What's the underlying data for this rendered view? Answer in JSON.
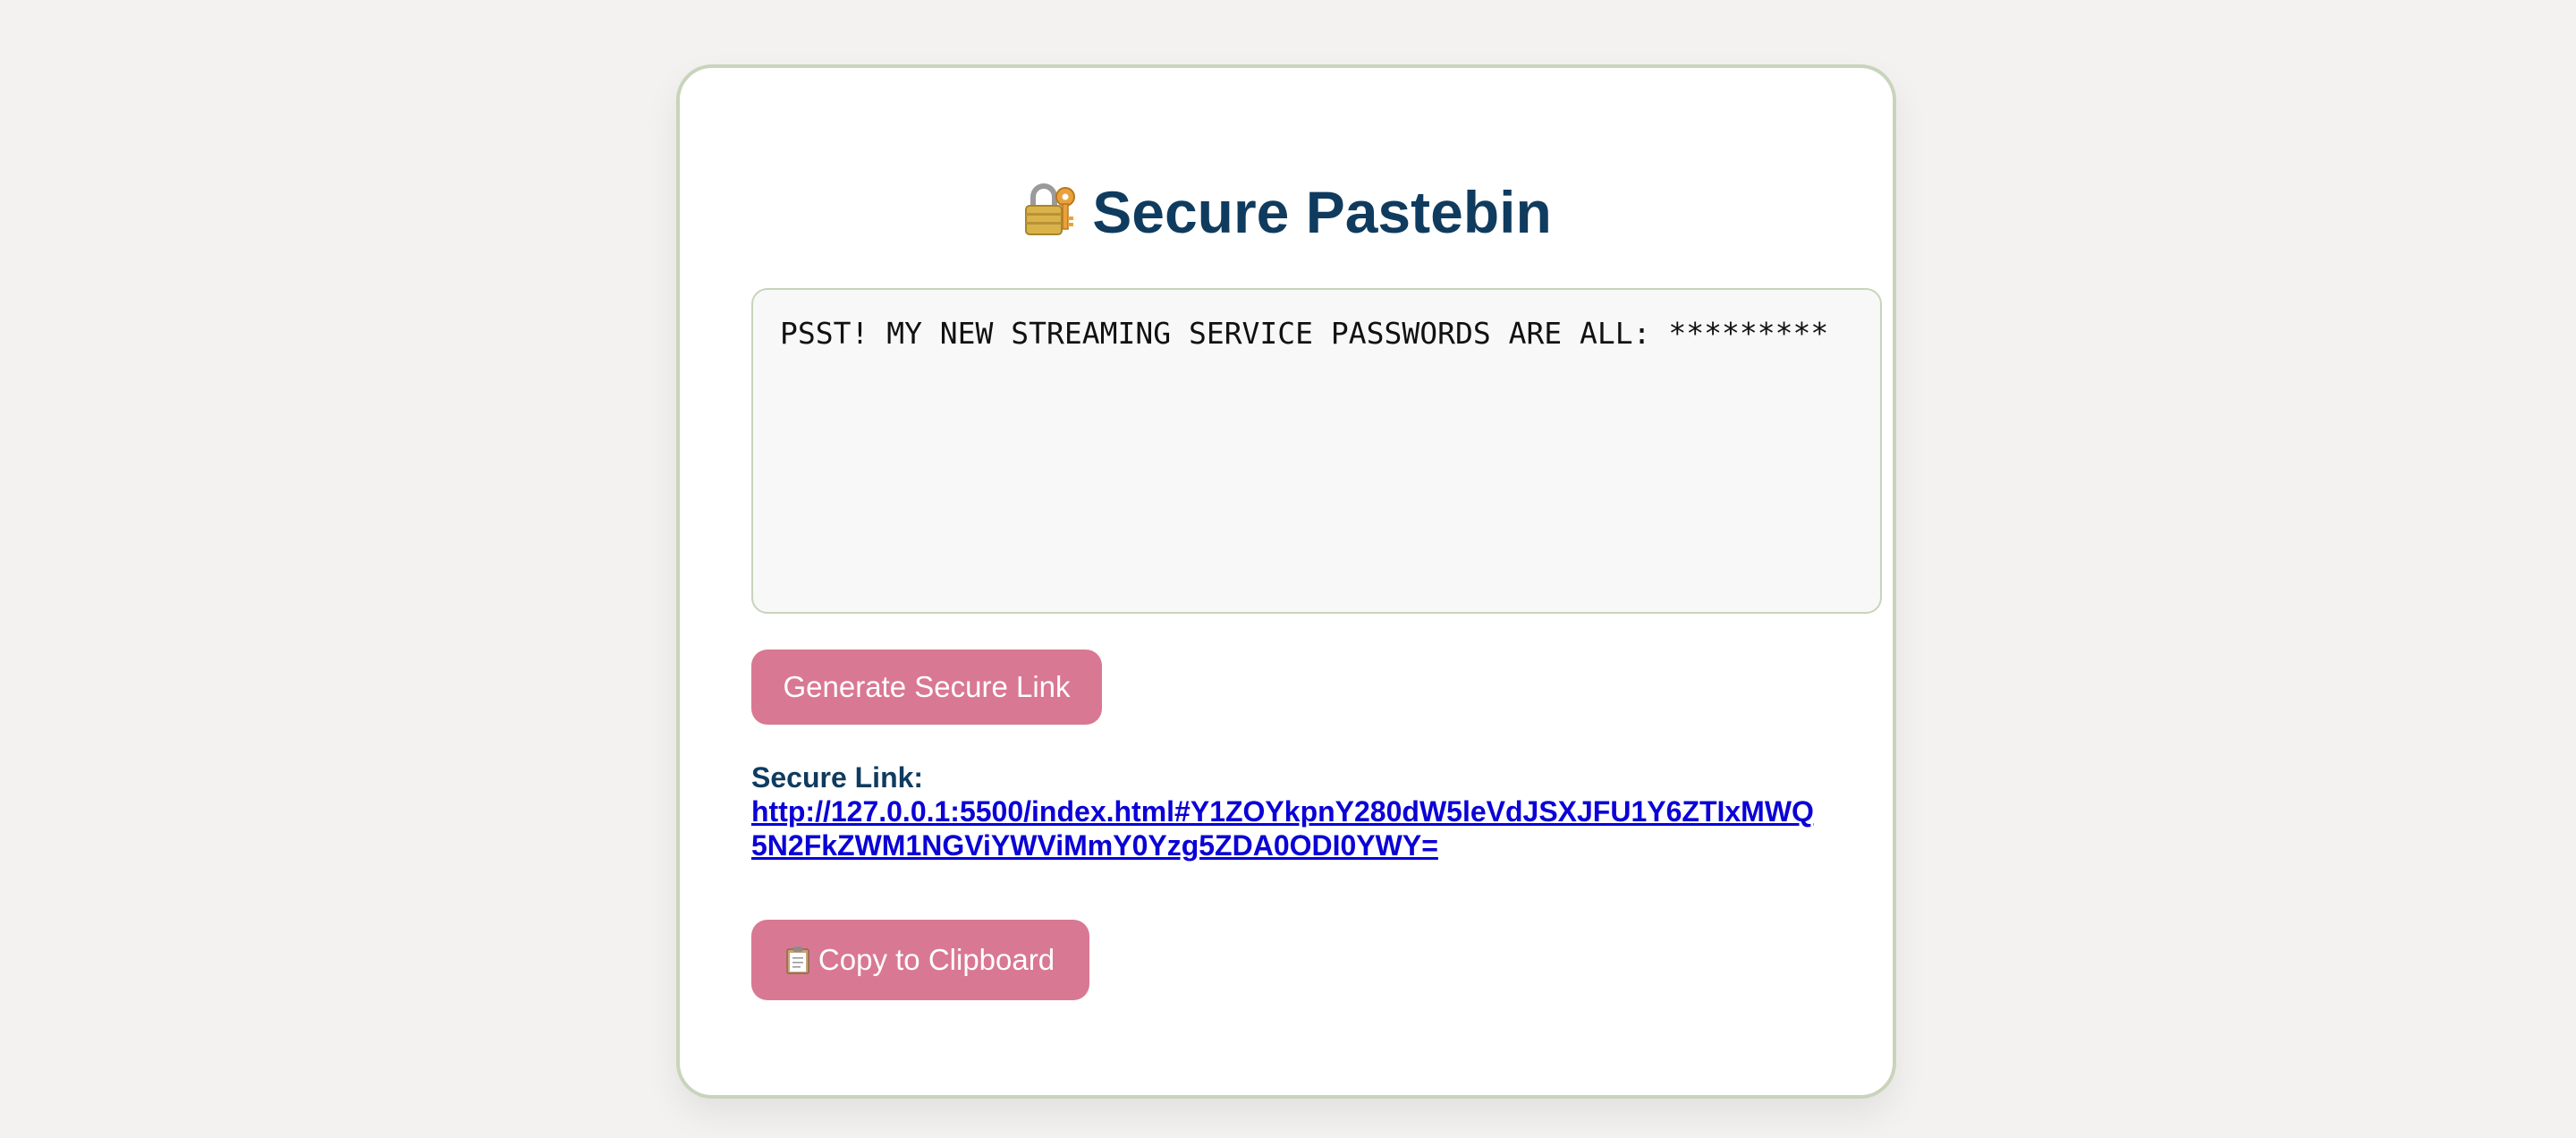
{
  "app": {
    "title": "Secure Pastebin",
    "title_icon": "lock-with-key-icon"
  },
  "paste": {
    "content": "PSST! MY NEW STREAMING SERVICE PASSWORDS ARE ALL: *********"
  },
  "actions": {
    "generate_label": "Generate Secure Link",
    "copy_label": "Copy to Clipboard",
    "copy_icon": "clipboard-icon"
  },
  "result": {
    "label": "Secure Link:",
    "url": "http://127.0.0.1:5500/index.html#Y1ZOYkpnY280dW5leVdJSXJFU1Y6ZTIxMWQ5N2FkZWM1NGViYWViMmY0Yzg5ZDA0ODI0YWY="
  },
  "colors": {
    "background": "#f3f2f0",
    "card_border": "#c8d4bb",
    "title_text": "#0f3b5f",
    "button_bg": "#d97893",
    "link": "#0a00d6"
  }
}
